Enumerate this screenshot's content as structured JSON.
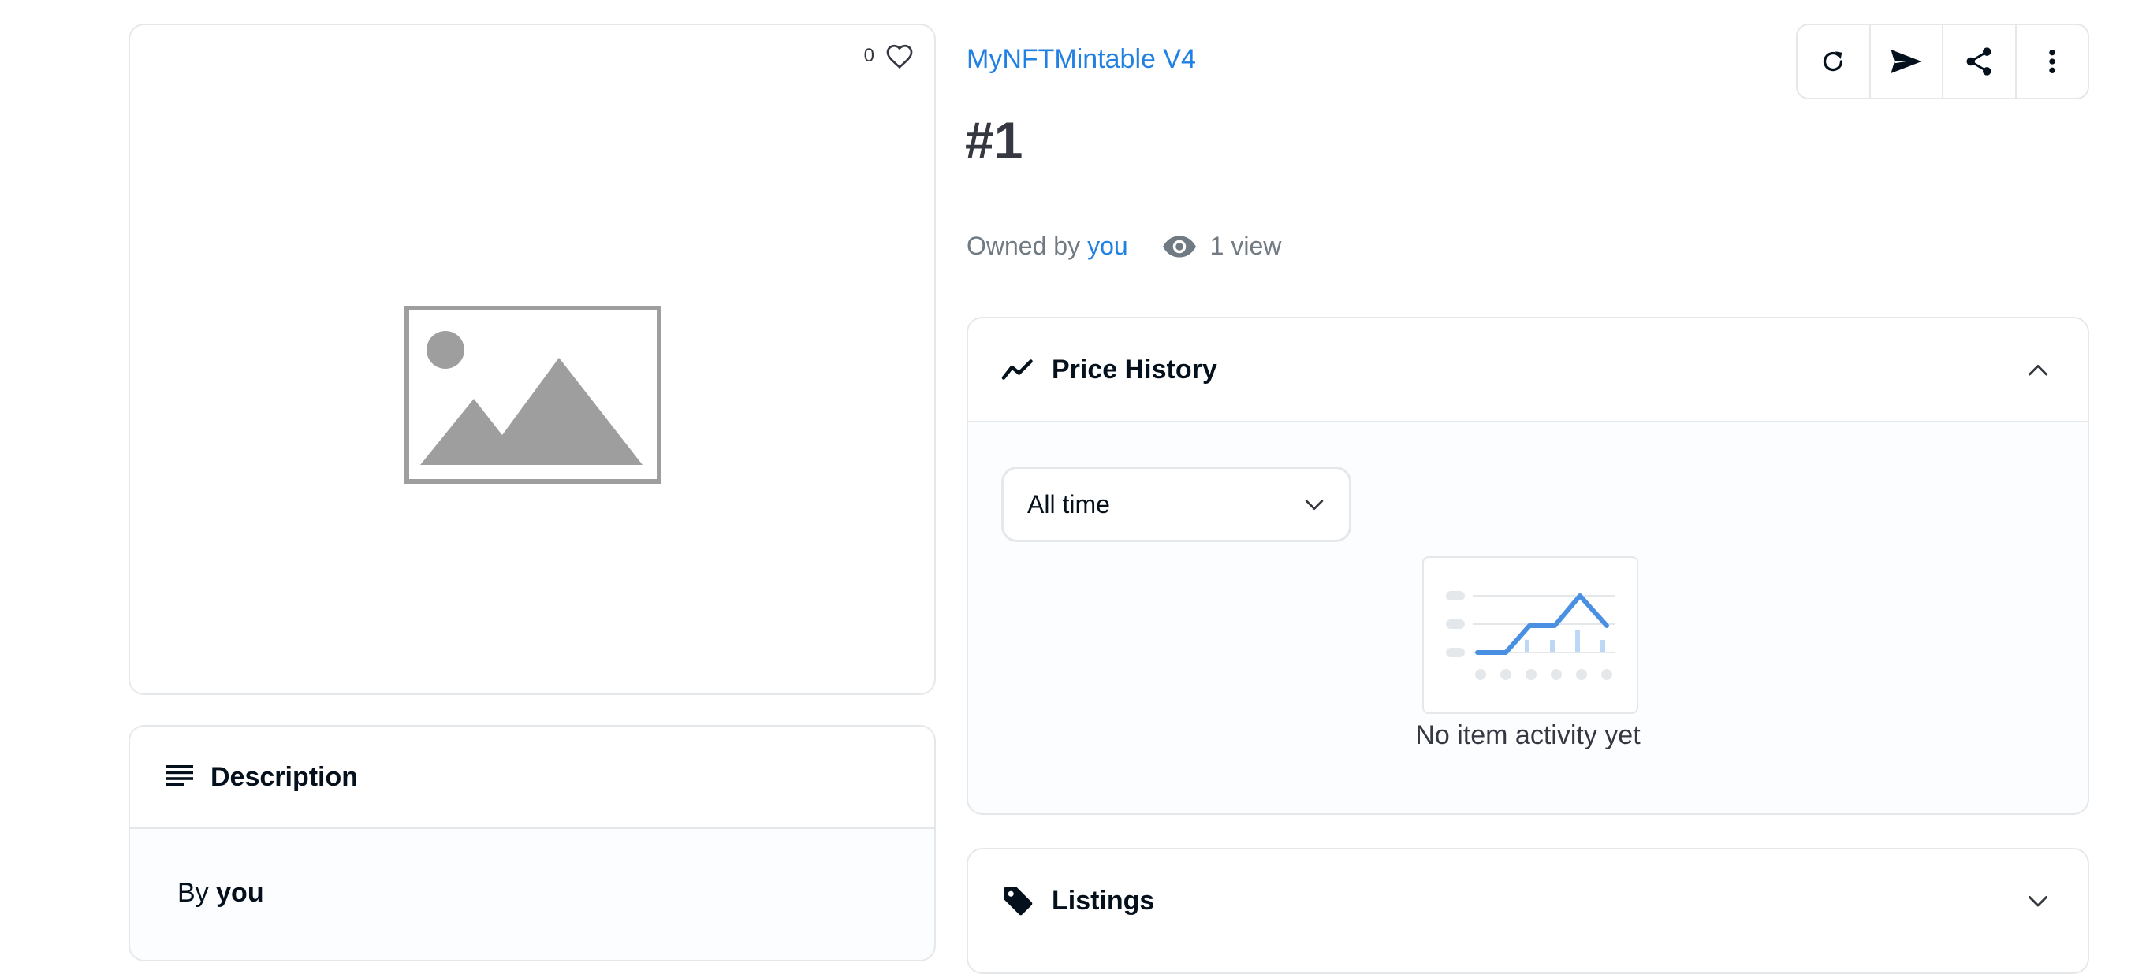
{
  "item": {
    "favorite_count": "0",
    "collection_name": "MyNFTMintable V4",
    "token_title": "#1",
    "owned_by_prefix": "Owned by",
    "owner": "you",
    "views": "1 view"
  },
  "actions": [
    {
      "icon": "refresh-icon"
    },
    {
      "icon": "send-icon"
    },
    {
      "icon": "share-icon"
    },
    {
      "icon": "more-vertical-icon"
    }
  ],
  "description": {
    "title": "Description",
    "by_prefix": "By",
    "by_name": "you"
  },
  "price_history": {
    "title": "Price History",
    "range_selected": "All time",
    "empty_text": "No item activity yet"
  },
  "listings": {
    "title": "Listings"
  },
  "colors": {
    "accent": "#2081e2",
    "border": "#e5e8eb",
    "text": "#04111d",
    "muted": "#707a83"
  }
}
